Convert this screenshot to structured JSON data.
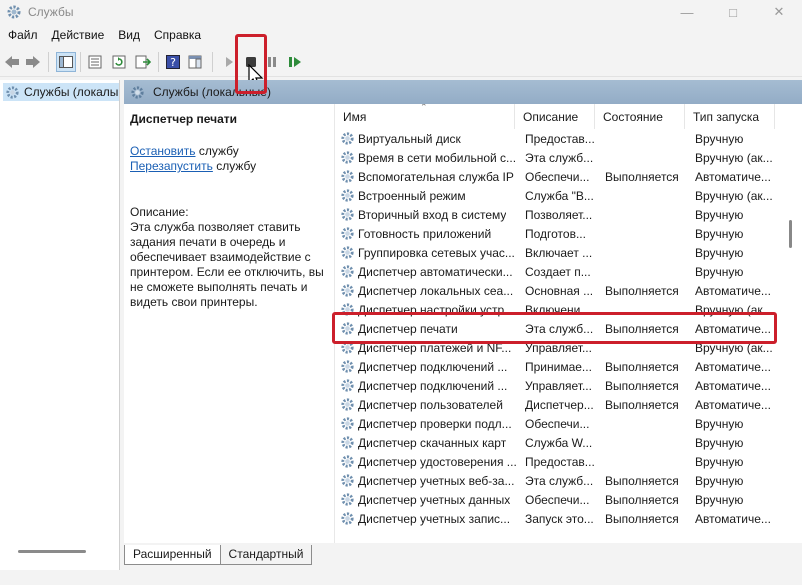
{
  "window": {
    "title": "Службы"
  },
  "menu": [
    "Файл",
    "Действие",
    "Вид",
    "Справка"
  ],
  "tree": {
    "root_label": "Службы (локалы"
  },
  "pane_header": "Службы (локальные)",
  "details": {
    "service_title": "Диспетчер печати",
    "stop_link": "Остановить",
    "stop_suffix": " службу",
    "restart_link": "Перезапустить",
    "restart_suffix": " службу",
    "desc_label": "Описание:",
    "desc_text": "Эта служба позволяет ставить задания печати в очередь и обеспечивает взаимодействие с принтером. Если ее отключить, вы не сможете выполнять печать и видеть свои принтеры."
  },
  "columns": [
    "Имя",
    "Описание",
    "Состояние",
    "Тип запуска"
  ],
  "rows": [
    [
      "Виртуальный диск",
      "Предостав...",
      "",
      "Вручную"
    ],
    [
      "Время в сети мобильной с...",
      "Эта служб...",
      "",
      "Вручную (ак..."
    ],
    [
      "Вспомогательная служба IP",
      "Обеспечи...",
      "Выполняется",
      "Автоматиче..."
    ],
    [
      "Встроенный режим",
      "Служба \"В...",
      "",
      "Вручную (ак..."
    ],
    [
      "Вторичный вход в систему",
      "Позволяет...",
      "",
      "Вручную"
    ],
    [
      "Готовность приложений",
      "Подготов...",
      "",
      "Вручную"
    ],
    [
      "Группировка сетевых учас...",
      "Включает ...",
      "",
      "Вручную"
    ],
    [
      "Диспетчер автоматически...",
      "Создает п...",
      "",
      "Вручную"
    ],
    [
      "Диспетчер локальных сеа...",
      "Основная ...",
      "Выполняется",
      "Автоматиче..."
    ],
    [
      "Диспетчер настройки устр...",
      "Включени...",
      "",
      "Вручную (ак..."
    ],
    [
      "Диспетчер печати",
      "Эта служб...",
      "Выполняется",
      "Автоматиче..."
    ],
    [
      "Диспетчер платежей и NF...",
      "Управляет...",
      "",
      "Вручную (ак..."
    ],
    [
      "Диспетчер подключений ...",
      "Принимае...",
      "Выполняется",
      "Автоматиче..."
    ],
    [
      "Диспетчер подключений ...",
      "Управляет...",
      "Выполняется",
      "Автоматиче..."
    ],
    [
      "Диспетчер пользователей",
      "Диспетчер...",
      "Выполняется",
      "Автоматиче..."
    ],
    [
      "Диспетчер проверки подл...",
      "Обеспечи...",
      "",
      "Вручную"
    ],
    [
      "Диспетчер скачанных карт",
      "Служба W...",
      "",
      "Вручную"
    ],
    [
      "Диспетчер удостоверения ...",
      "Предостав...",
      "",
      "Вручную"
    ],
    [
      "Диспетчер учетных веб-за...",
      "Эта служб...",
      "Выполняется",
      "Вручную"
    ],
    [
      "Диспетчер учетных данных",
      "Обеспечи...",
      "Выполняется",
      "Вручную"
    ],
    [
      "Диспетчер учетных запис...",
      "Запуск это...",
      "Выполняется",
      "Автоматиче..."
    ]
  ],
  "tabs": [
    "Расширенный",
    "Стандартный"
  ],
  "colors": {
    "annotation": "#cc1f2b",
    "header": "#9db5cc",
    "link": "#1a5fb4",
    "tree_selected": "#cce4f7"
  }
}
